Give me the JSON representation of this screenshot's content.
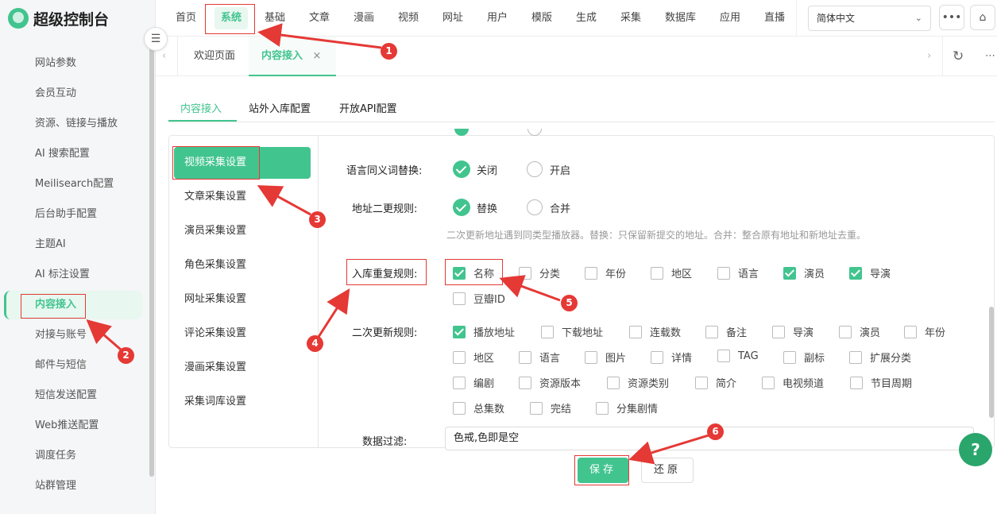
{
  "app": {
    "title": "超级控制台"
  },
  "sidebar": {
    "items": [
      "网站参数",
      "会员互动",
      "资源、链接与播放",
      "AI 搜索配置",
      "Meilisearch配置",
      "后台助手配置",
      "主题AI",
      "AI 标注设置",
      "内容接入",
      "对接与账号",
      "邮件与短信",
      "短信发送配置",
      "Web推送配置",
      "调度任务",
      "站群管理"
    ],
    "active": "内容接入"
  },
  "topnav": {
    "items": [
      "首页",
      "系统",
      "基础",
      "文章",
      "漫画",
      "视频",
      "网址",
      "用户",
      "模版",
      "生成",
      "采集",
      "数据库",
      "应用",
      "直播"
    ],
    "active": "系统",
    "language": "简体中文"
  },
  "tabs": {
    "items": [
      "欢迎页面",
      "内容接入"
    ],
    "active": "内容接入",
    "close": "×"
  },
  "subtabs": [
    "内容接入",
    "站外入库配置",
    "开放API配置"
  ],
  "left_menu": [
    "视频采集设置",
    "文章采集设置",
    "演员采集设置",
    "角色采集设置",
    "网址采集设置",
    "评论采集设置",
    "漫画采集设置",
    "采集词库设置"
  ],
  "form": {
    "synonym_label": "语言同义词替换:",
    "synonym_options": [
      "关闭",
      "开启"
    ],
    "addr_label": "地址二更规则:",
    "addr_options": [
      "替换",
      "合并"
    ],
    "addr_hint": "二次更新地址遇到同类型播放器。替换：只保留新提交的地址。合并：整合原有地址和新地址去重。",
    "dup_label": "入库重复规则:",
    "dup_options": [
      {
        "label": "名称",
        "checked": true
      },
      {
        "label": "分类",
        "checked": false
      },
      {
        "label": "年份",
        "checked": false
      },
      {
        "label": "地区",
        "checked": false
      },
      {
        "label": "语言",
        "checked": false
      },
      {
        "label": "演员",
        "checked": true
      },
      {
        "label": "导演",
        "checked": true
      },
      {
        "label": "豆瓣ID",
        "checked": false
      }
    ],
    "update_label": "二次更新规则:",
    "update_options": [
      {
        "label": "播放地址",
        "checked": true
      },
      {
        "label": "下载地址",
        "checked": false
      },
      {
        "label": "连载数",
        "checked": false
      },
      {
        "label": "备注",
        "checked": false
      },
      {
        "label": "导演",
        "checked": false
      },
      {
        "label": "演员",
        "checked": false
      },
      {
        "label": "年份",
        "checked": false
      },
      {
        "label": "地区",
        "checked": false
      },
      {
        "label": "语言",
        "checked": false
      },
      {
        "label": "图片",
        "checked": false
      },
      {
        "label": "详情",
        "checked": false
      },
      {
        "label": "TAG",
        "checked": false
      },
      {
        "label": "副标",
        "checked": false
      },
      {
        "label": "扩展分类",
        "checked": false
      },
      {
        "label": "编剧",
        "checked": false
      },
      {
        "label": "资源版本",
        "checked": false
      },
      {
        "label": "资源类别",
        "checked": false
      },
      {
        "label": "简介",
        "checked": false
      },
      {
        "label": "电视频道",
        "checked": false
      },
      {
        "label": "节目周期",
        "checked": false
      },
      {
        "label": "总集数",
        "checked": false
      },
      {
        "label": "完结",
        "checked": false
      },
      {
        "label": "分集剧情",
        "checked": false
      }
    ],
    "filter_label": "数据过滤:",
    "filter_value": "色戒,色即是空"
  },
  "buttons": {
    "save": "保存",
    "reset": "还原"
  },
  "help": "?",
  "annotations": [
    "1",
    "2",
    "3",
    "4",
    "5",
    "6"
  ],
  "colors": {
    "accent": "#42c48f",
    "annotation": "#e53935"
  }
}
